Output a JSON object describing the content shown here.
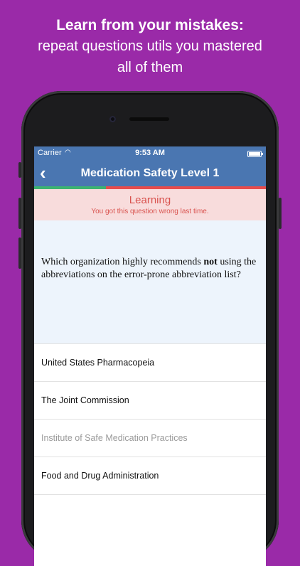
{
  "promo": {
    "headline": "Learn from your mistakes:",
    "line2": "repeat questions utils you mastered",
    "line3": "all of them"
  },
  "status_bar": {
    "carrier": "Carrier",
    "time": "9:53 AM"
  },
  "nav": {
    "back_icon": "chevron-left",
    "title": "Medication Safety Level 1"
  },
  "progress": {
    "correct_fraction": 0.31,
    "correct_color": "#3cb371",
    "wrong_color": "#e74c4c"
  },
  "status": {
    "label": "Learning",
    "message": "You got this question wrong last time."
  },
  "question": {
    "before": "Which organization highly recommends ",
    "emphasis": "not",
    "after": " using the abbreviations on the error-prone abbreviation list?"
  },
  "answers": [
    {
      "text": "United States Pharmacopeia",
      "state": "normal"
    },
    {
      "text": "The Joint Commission",
      "state": "normal"
    },
    {
      "text": "Institute of Safe Medication Practices",
      "state": "disabled"
    },
    {
      "text": "Food and Drug Administration",
      "state": "normal"
    }
  ],
  "colors": {
    "background": "#9a2aa8",
    "nav": "#4a76b1",
    "banner": "#f8dcdc",
    "question_bg": "#edf4fc"
  }
}
